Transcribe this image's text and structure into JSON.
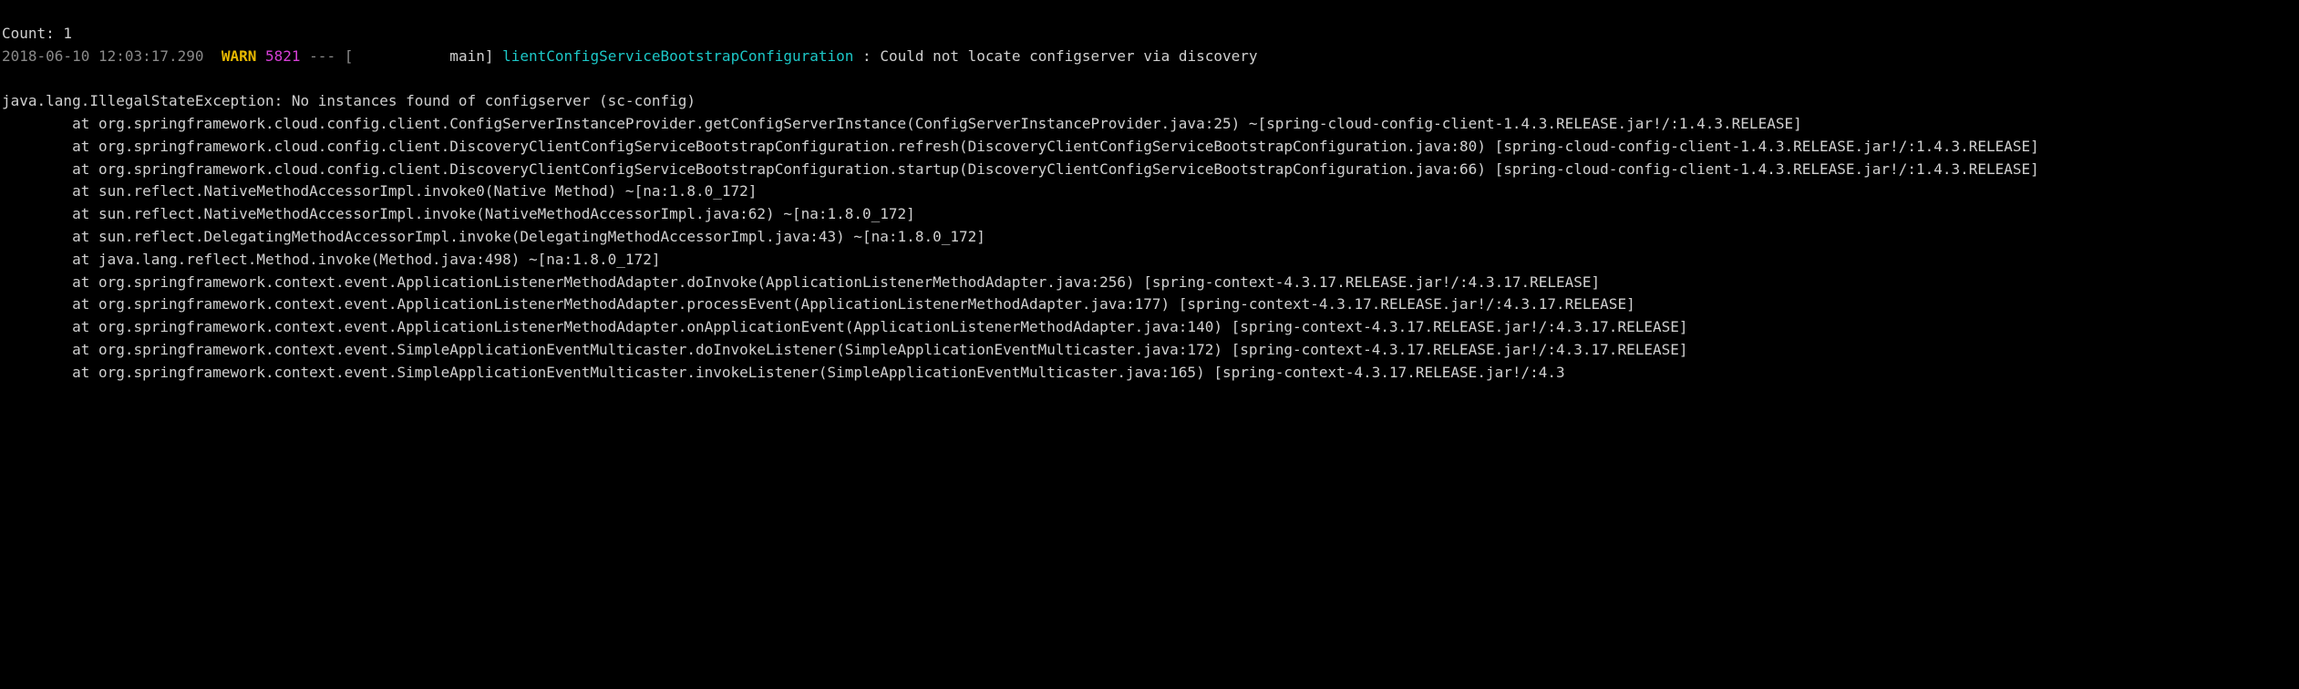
{
  "truncated_top": "Count: 1",
  "header": {
    "timestamp": "2018-06-10 12:03:17.290",
    "level": "WARN",
    "pid": "5821",
    "separator": "--- [",
    "thread": "           main]",
    "logger": "lientConfigServiceBootstrapConfiguration",
    "colon": " : ",
    "message": "Could not locate configserver via discovery"
  },
  "exception_line": "java.lang.IllegalStateException: No instances found of configserver (sc-config)",
  "stack": [
    "        at org.springframework.cloud.config.client.ConfigServerInstanceProvider.getConfigServerInstance(ConfigServerInstanceProvider.java:25) ~[spring-cloud-config-client-1.4.3.RELEASE.jar!/:1.4.3.RELEASE]",
    "        at org.springframework.cloud.config.client.DiscoveryClientConfigServiceBootstrapConfiguration.refresh(DiscoveryClientConfigServiceBootstrapConfiguration.java:80) [spring-cloud-config-client-1.4.3.RELEASE.jar!/:1.4.3.RELEASE]",
    "        at org.springframework.cloud.config.client.DiscoveryClientConfigServiceBootstrapConfiguration.startup(DiscoveryClientConfigServiceBootstrapConfiguration.java:66) [spring-cloud-config-client-1.4.3.RELEASE.jar!/:1.4.3.RELEASE]",
    "        at sun.reflect.NativeMethodAccessorImpl.invoke0(Native Method) ~[na:1.8.0_172]",
    "        at sun.reflect.NativeMethodAccessorImpl.invoke(NativeMethodAccessorImpl.java:62) ~[na:1.8.0_172]",
    "        at sun.reflect.DelegatingMethodAccessorImpl.invoke(DelegatingMethodAccessorImpl.java:43) ~[na:1.8.0_172]",
    "        at java.lang.reflect.Method.invoke(Method.java:498) ~[na:1.8.0_172]",
    "        at org.springframework.context.event.ApplicationListenerMethodAdapter.doInvoke(ApplicationListenerMethodAdapter.java:256) [spring-context-4.3.17.RELEASE.jar!/:4.3.17.RELEASE]",
    "        at org.springframework.context.event.ApplicationListenerMethodAdapter.processEvent(ApplicationListenerMethodAdapter.java:177) [spring-context-4.3.17.RELEASE.jar!/:4.3.17.RELEASE]",
    "        at org.springframework.context.event.ApplicationListenerMethodAdapter.onApplicationEvent(ApplicationListenerMethodAdapter.java:140) [spring-context-4.3.17.RELEASE.jar!/:4.3.17.RELEASE]",
    "        at org.springframework.context.event.SimpleApplicationEventMulticaster.doInvokeListener(SimpleApplicationEventMulticaster.java:172) [spring-context-4.3.17.RELEASE.jar!/:4.3.17.RELEASE]",
    "        at org.springframework.context.event.SimpleApplicationEventMulticaster.invokeListener(SimpleApplicationEventMulticaster.java:165) [spring-context-4.3.17.RELEASE.jar!/:4.3"
  ]
}
